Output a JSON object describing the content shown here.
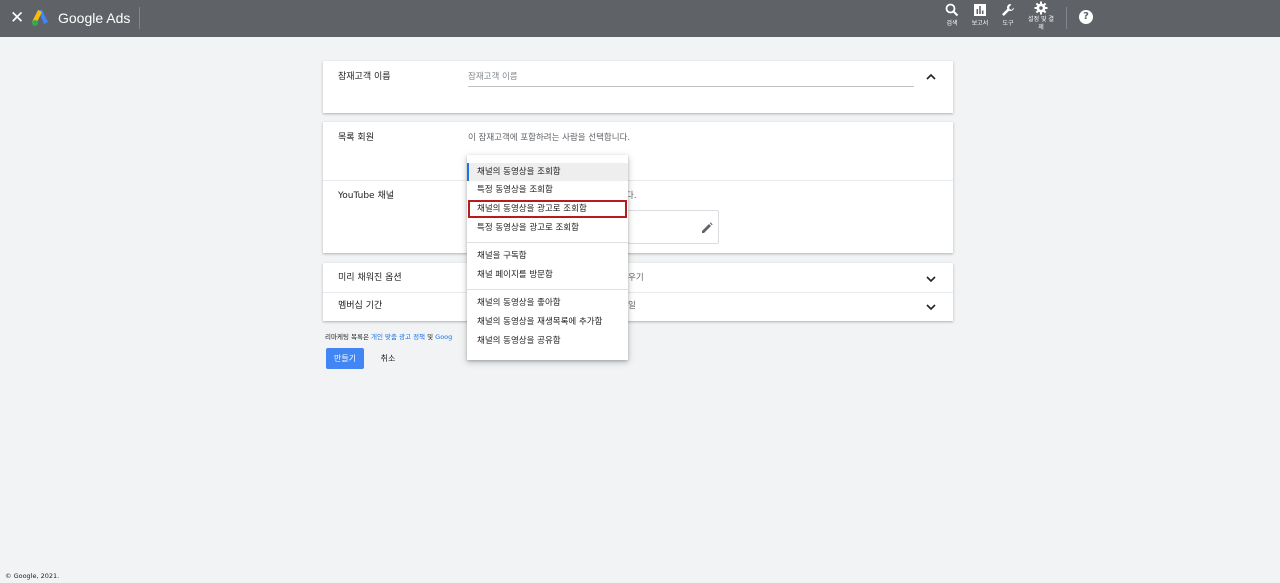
{
  "header": {
    "close_icon": "close-icon",
    "brand": "Google Ads",
    "tools": [
      {
        "label": "검색",
        "icon": "search-icon"
      },
      {
        "label": "보고서",
        "icon": "reports-icon"
      },
      {
        "label": "도구",
        "icon": "wrench-icon"
      },
      {
        "label": "설정 및 결제",
        "icon": "gear-icon"
      }
    ],
    "help_glyph": "?"
  },
  "audience_name": {
    "label": "잠재고객 이름",
    "placeholder": "잠재고객 이름"
  },
  "members": {
    "label": "목록 회원",
    "hint": "이 잠재고객에 포함하려는 사람을 선택합니다."
  },
  "youtube_channel": {
    "label": "YouTube 채널",
    "hint_visible_tail": "다."
  },
  "prefill": {
    "label": "미리 채워진 옵션",
    "value_visible_tail": "우기"
  },
  "membership": {
    "label": "멤버십 기간",
    "value_visible_tail": "일"
  },
  "policy": {
    "prefix": "리마케팅 목록은 ",
    "link1": "개인 맞춤 광고 정책",
    "middle": " 및 ",
    "link2_visible": "Goog"
  },
  "buttons": {
    "create": "만들기",
    "cancel": "취소"
  },
  "dropdown": {
    "groups": [
      [
        "채널의 동영상을 조회함",
        "특정 동영상을 조회함",
        "채널의 동영상을 광고로 조회함",
        "특정 동영상을 광고로 조회함"
      ],
      [
        "채널을 구독함",
        "채널 페이지를 방문함"
      ],
      [
        "채널의 동영상을 좋아함",
        "채널의 동영상을 재생목록에 추가함",
        "채널의 동영상을 공유함"
      ]
    ],
    "selected": "채널의 동영상을 조회함",
    "highlighted": "채널의 동영상을 광고로 조회함"
  },
  "footer": "© Google, 2021.",
  "colors": {
    "header_bg": "#5f6368",
    "page_bg": "#f1f3f4",
    "primary_button": "#4285f4",
    "link": "#1a73e8",
    "highlight_box": "#b71c1c"
  }
}
